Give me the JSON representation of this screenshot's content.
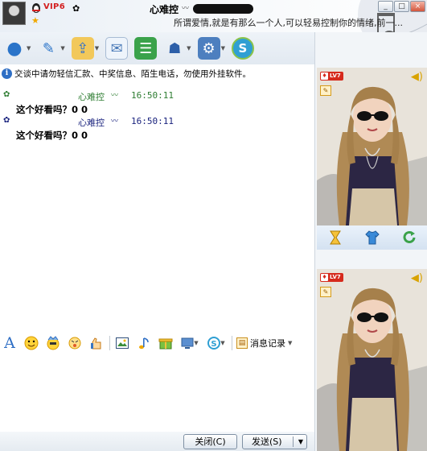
{
  "title": {
    "vip": "VIP6",
    "nickname": "心难控",
    "nick_mark": "〰",
    "signature": "所谓爱情,就是有那么一个人,可以轻易控制你的情绪,前一..."
  },
  "window_controls": [
    "_",
    "□",
    "×"
  ],
  "toolbar": {
    "items": [
      {
        "icon": "webcam-icon",
        "glyph": "●"
      },
      {
        "icon": "microphone-icon",
        "glyph": "✎"
      },
      {
        "icon": "folder-transfer-icon",
        "glyph": "⇪"
      },
      {
        "icon": "email-icon",
        "glyph": "✉"
      },
      {
        "icon": "message-board-icon",
        "glyph": "☰"
      },
      {
        "icon": "security-icon",
        "glyph": "☗"
      },
      {
        "icon": "settings-icon",
        "glyph": "⚙"
      },
      {
        "icon": "soso-icon",
        "glyph": "S"
      }
    ]
  },
  "notice": {
    "info_glyph": "i",
    "text": "交谈中请勿轻信汇款、中奖信息、陌生电话，勿使用外挂软件。"
  },
  "messages": [
    {
      "sender": "心难控",
      "mark": "〰",
      "time": "16:50:11",
      "text": "这个好看吗？0 0",
      "flag": "✿",
      "color": "#2e7d32"
    },
    {
      "sender": "心难控",
      "mark": "〰",
      "time": "16:50:11",
      "text": "这个好看吗？0 0",
      "flag": "✿",
      "color": "#1a237e"
    }
  ],
  "format_bar": {
    "font_glyph": "A",
    "history_label": "消息记录",
    "history_glyph": "▤"
  },
  "buttons": {
    "close": "关闭(C)",
    "send": "发送(S)",
    "send_arrow": "▼"
  },
  "right_panel": {
    "level": "LV7",
    "speaker_glyph": "◀)",
    "edit_glyph": "✎"
  },
  "colors": {
    "accent": "#2f6fc5",
    "vip_red": "#d31f1f",
    "window_bg": "#e9eff6"
  }
}
